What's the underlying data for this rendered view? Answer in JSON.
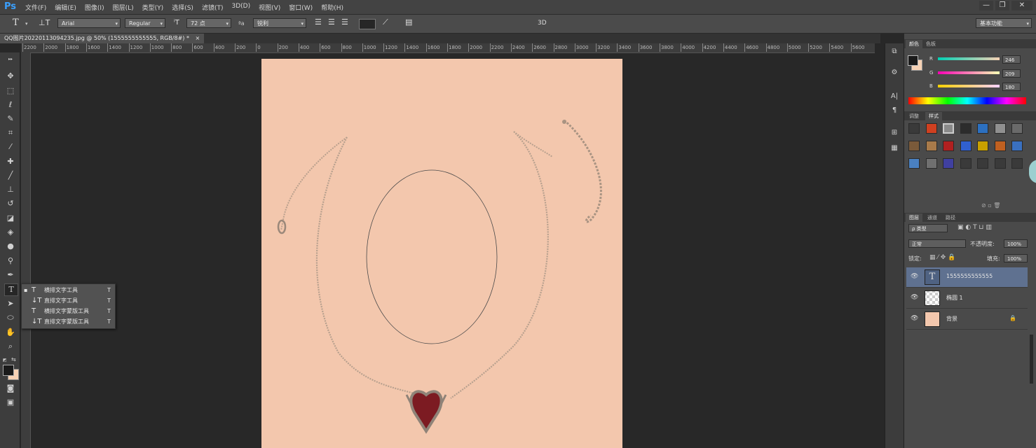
{
  "app": {
    "logo": "Ps"
  },
  "menu": [
    "文件(F)",
    "编辑(E)",
    "图像(I)",
    "图层(L)",
    "类型(Y)",
    "选择(S)",
    "滤镜(T)",
    "3D(D)",
    "视图(V)",
    "窗口(W)",
    "帮助(H)"
  ],
  "window_controls": {
    "minimize": "—",
    "restore": "❐",
    "close": "✕"
  },
  "options": {
    "tool_glyph": "T",
    "font_family": "Arial",
    "font_style": "Regular",
    "font_size": "72 点",
    "aa_label": "ªa",
    "anti_alias": "锐利",
    "threed": "3D",
    "workspace": "基本功能"
  },
  "document": {
    "tab_title": "QQ图片20220113094235.jpg @ 50% (1555555555555, RGB/8#) *",
    "close": "×"
  },
  "ruler_ticks": [
    "2200",
    "2000",
    "1800",
    "1600",
    "1400",
    "1200",
    "1000",
    "800",
    "600",
    "400",
    "200",
    "0",
    "200",
    "400",
    "600",
    "800",
    "1000",
    "1200",
    "1400",
    "1600",
    "1800",
    "2000",
    "2200",
    "2400",
    "2600",
    "2800",
    "3000",
    "3200",
    "3400",
    "3600",
    "3800",
    "4000",
    "4200",
    "4400",
    "4600",
    "4800",
    "5000",
    "5200",
    "5400",
    "5600"
  ],
  "type_flyout": [
    {
      "glyph": "T",
      "label": "横排文字工具",
      "shortcut": "T",
      "active": true
    },
    {
      "glyph": "↓T",
      "label": "直排文字工具",
      "shortcut": "T",
      "active": false
    },
    {
      "glyph": "T",
      "label": "横排文字蒙版工具",
      "shortcut": "T",
      "active": false
    },
    {
      "glyph": "↓T",
      "label": "直排文字蒙版工具",
      "shortcut": "T",
      "active": false
    }
  ],
  "color_panel": {
    "tabs": [
      "颜色",
      "色板"
    ],
    "channels": [
      {
        "label": "R",
        "value": "246"
      },
      {
        "label": "G",
        "value": "209"
      },
      {
        "label": "B",
        "value": "180"
      }
    ],
    "foreground": "#1a1a1a",
    "background": "#f6d1b4"
  },
  "styles_panel": {
    "tabs": [
      "调整",
      "样式"
    ]
  },
  "layers_panel": {
    "tabs": [
      "图层",
      "通道",
      "路径"
    ],
    "filter": "ρ 类型",
    "blend_mode": "正常",
    "opacity_label": "不透明度:",
    "opacity": "100%",
    "lock_label": "锁定:",
    "fill_label": "填充:",
    "fill": "100%",
    "layers": [
      {
        "name": "1555555555555",
        "kind": "text",
        "selected": true
      },
      {
        "name": "椭圆 1",
        "kind": "shape",
        "selected": false
      },
      {
        "name": "背景",
        "kind": "image",
        "selected": false,
        "locked": true
      }
    ]
  },
  "colors": {
    "canvas": "#f3c7ad",
    "workspace": "#282828",
    "selection": "#5f7190"
  }
}
